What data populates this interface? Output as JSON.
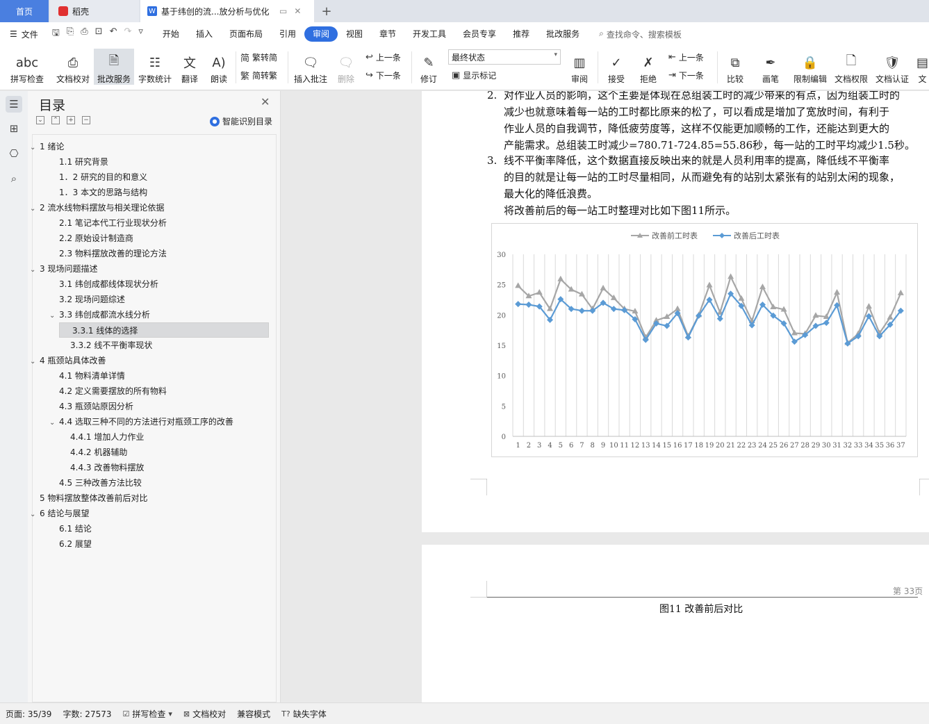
{
  "tabs": {
    "home": "首页",
    "daoke": "稻壳",
    "doc": "基于纬创的流...放分析与优化"
  },
  "menu": {
    "file": "文件",
    "items": [
      "开始",
      "插入",
      "页面布局",
      "引用",
      "审阅",
      "视图",
      "章节",
      "开发工具",
      "会员专享",
      "推荐",
      "批改服务"
    ],
    "active_index": 4,
    "search": "查找命令、搜索模板"
  },
  "ribbon": {
    "spell": "拼写检查",
    "proofread": "文档校对",
    "correct": "批改服务",
    "wordcount": "字数统计",
    "translate": "翻译",
    "read": "朗读",
    "to_trad": "繁转简",
    "to_simp": "简转繁",
    "insert_comment": "插入批注",
    "delete": "删除",
    "prev": "上一条",
    "next": "下一条",
    "revise": "修订",
    "final_state": "最终状态",
    "show_marks": "显示标记",
    "review": "审阅",
    "accept": "接受",
    "reject": "拒绝",
    "prev2": "上一条",
    "next2": "下一条",
    "compare": "比较",
    "pen": "画笔",
    "restrict": "限制编辑",
    "doc_perm": "文档权限",
    "doc_cert": "文档认证",
    "more": "文"
  },
  "nav": {
    "title": "目录",
    "smart": "智能识别目录",
    "toc": [
      {
        "label": "1  绪论",
        "level": 1,
        "chev": "v"
      },
      {
        "label": "1.1 研究背景",
        "level": 2
      },
      {
        "label": "1．2 研究的目的和意义",
        "level": 2
      },
      {
        "label": "1．3 本文的思路与结构",
        "level": 2
      },
      {
        "label": "2  流水线物料摆放与相关理论依据",
        "level": 1,
        "chev": "v"
      },
      {
        "label": "2.1 笔记本代工行业现状分析",
        "level": 2
      },
      {
        "label": "2.2 原始设计制造商",
        "level": 2
      },
      {
        "label": "2.3 物料摆放改善的理论方法",
        "level": 2
      },
      {
        "label": "3 现场问题描述",
        "level": 1,
        "chev": "v"
      },
      {
        "label": "3.1 纬创成都线体现状分析",
        "level": 2
      },
      {
        "label": "3.2 现场问题综述",
        "level": 2
      },
      {
        "label": "3.3 纬创成都流水线分析",
        "level": 2,
        "chev": "v"
      },
      {
        "label": "3.3.1 线体的选择",
        "level": 3,
        "selected": true
      },
      {
        "label": "3.3.2 线不平衡率现状",
        "level": 3
      },
      {
        "label": "4 瓶颈站具体改善",
        "level": 1,
        "chev": "v"
      },
      {
        "label": "4.1 物料清单详情",
        "level": 2
      },
      {
        "label": "4.2 定义需要摆放的所有物料",
        "level": 2
      },
      {
        "label": "4.3 瓶颈站原因分析",
        "level": 2
      },
      {
        "label": "4.4 选取三种不同的方法进行对瓶颈工序的改善",
        "level": 2,
        "chev": "v"
      },
      {
        "label": "4.4.1 增加人力作业",
        "level": 3
      },
      {
        "label": "4.4.2 机器辅助",
        "level": 3
      },
      {
        "label": "4.4.3 改善物料摆放",
        "level": 3
      },
      {
        "label": "4.5 三种改善方法比较",
        "level": 2
      },
      {
        "label": "5  物料摆放整体改善前后对比",
        "level": 1
      },
      {
        "label": "6  结论与展望",
        "level": 1,
        "chev": "v"
      },
      {
        "label": "6.1 结论",
        "level": 2
      },
      {
        "label": "6.2 展望",
        "level": 2
      }
    ]
  },
  "doc": {
    "item2_num": "2.",
    "item2_lines": [
      "对作业人员的影响，这个主要是体现在总组装工时的减少带来的有点，因为组装工时的",
      "减少也就意味着每一站的工时都比原来的松了，可以看成是增加了宽放时间，有利于",
      "作业人员的自我调节，降低疲劳度等，这样不仅能更加顺畅的工作，还能达到更大的",
      "产能需求。总组装工时减少=780.71-724.85=55.86秒，每一站的工时平均减少1.5秒。"
    ],
    "item3_num": "3.",
    "item3_lines": [
      "线不平衡率降低，这个数据直接反映出来的就是人员利用率的提高，降低线不平衡率",
      "的目的就是让每一站的工时尽量相同，从而避免有的站别太紧张有的站别太闲的现象，",
      "最大化的降低浪费。"
    ],
    "after_line": "将改善前后的每一站工时整理对比如下图11所示。",
    "page_number": "第 33页",
    "caption": "图11   改善前后对比"
  },
  "chart_data": {
    "type": "line",
    "x": [
      1,
      2,
      3,
      4,
      5,
      6,
      7,
      8,
      9,
      10,
      11,
      12,
      13,
      14,
      15,
      16,
      17,
      18,
      19,
      20,
      21,
      22,
      23,
      24,
      25,
      26,
      27,
      28,
      29,
      30,
      31,
      32,
      33,
      34,
      35,
      36,
      37
    ],
    "ylim": [
      0,
      30
    ],
    "yticks": [
      0,
      5,
      10,
      15,
      20,
      25,
      30
    ],
    "grid": "vertical",
    "legend": "top",
    "series": [
      {
        "name": "改善前工时表",
        "color": "#a6a6a6",
        "marker": "triangle",
        "values": [
          24.8,
          23.1,
          23.7,
          21.0,
          25.9,
          24.2,
          23.4,
          21.0,
          24.4,
          22.8,
          21.0,
          20.6,
          16.3,
          19.1,
          19.7,
          21.0,
          16.5,
          20.0,
          24.9,
          20.4,
          26.3,
          22.7,
          19.0,
          24.6,
          21.3,
          20.9,
          17.0,
          16.9,
          19.9,
          19.7,
          23.7,
          15.4,
          16.9,
          21.4,
          17.0,
          19.6,
          23.6
        ]
      },
      {
        "name": "改善后工时表",
        "color": "#5b9bd5",
        "marker": "diamond",
        "values": [
          21.8,
          21.7,
          21.4,
          19.2,
          22.6,
          21.0,
          20.7,
          20.7,
          22.0,
          21.0,
          20.8,
          19.3,
          15.9,
          18.6,
          18.2,
          20.3,
          16.3,
          19.9,
          22.5,
          19.4,
          23.5,
          21.5,
          18.3,
          21.7,
          19.9,
          18.6,
          15.6,
          16.7,
          18.2,
          18.7,
          21.6,
          15.3,
          16.5,
          19.8,
          16.5,
          18.4,
          20.7
        ]
      }
    ]
  },
  "status": {
    "page": "页面: 35/39",
    "words": "字数: 27573",
    "spell": "拼写检查",
    "proofread": "文档校对",
    "compat": "兼容模式",
    "missing_font": "缺失字体"
  }
}
